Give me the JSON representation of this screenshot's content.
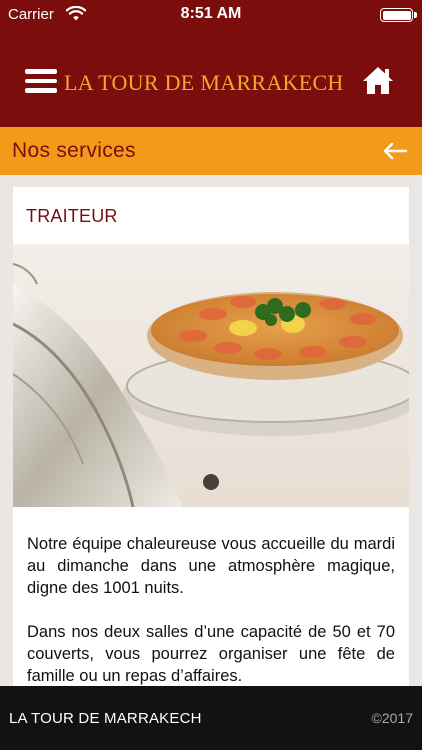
{
  "status_bar": {
    "carrier": "Carrier",
    "time": "8:51 AM",
    "wifi_icon": "wifi-icon",
    "battery_level": 1.0
  },
  "header": {
    "title": "LA TOUR DE MARRAKECH",
    "menu_icon": "hamburger-menu-icon",
    "home_icon": "home-icon",
    "colors": {
      "background": "#7b0d0d",
      "title": "#f0a92a"
    }
  },
  "section": {
    "title": "Nos services",
    "back_icon": "arrow-left-icon",
    "color": "#f39b19"
  },
  "card": {
    "title": "TRAITEUR",
    "carousel": {
      "pages": 1,
      "active": 1
    },
    "paragraphs": [
      "Notre équipe chaleureuse vous accueille du mardi au dimanche dans une atmosphère magique, digne des 1001 nuits.",
      "Dans nos deux salles d’une capacité de 50 et 70 couverts, vous pourrez organiser une fête de famille ou un repas d’affaires."
    ]
  },
  "footer": {
    "brand": "LA TOUR DE MARRAKECH",
    "copyright": "©2017"
  }
}
